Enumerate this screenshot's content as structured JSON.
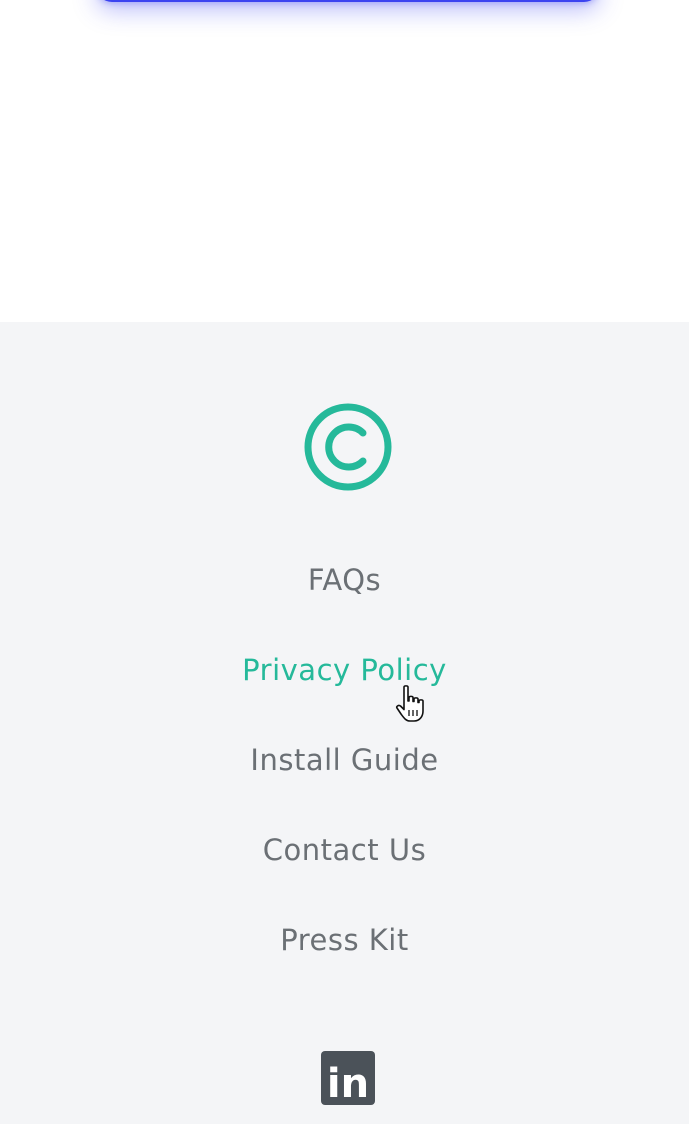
{
  "cta": {
    "color": "#3b43f0"
  },
  "footer": {
    "logo_icon": "copyright-icon",
    "accent_color": "#25b99a",
    "link_color": "#6b7075",
    "background": "#f4f5f7",
    "links": [
      {
        "label": "FAQs",
        "active": false
      },
      {
        "label": "Privacy Policy",
        "active": true
      },
      {
        "label": "Install Guide",
        "active": false
      },
      {
        "label": "Contact Us",
        "active": false
      },
      {
        "label": "Press Kit",
        "active": false
      }
    ],
    "social": {
      "icon": "linkedin-icon",
      "text": "in",
      "color": "#4b5259"
    }
  },
  "cursor": {
    "icon": "hand-pointer-icon"
  }
}
